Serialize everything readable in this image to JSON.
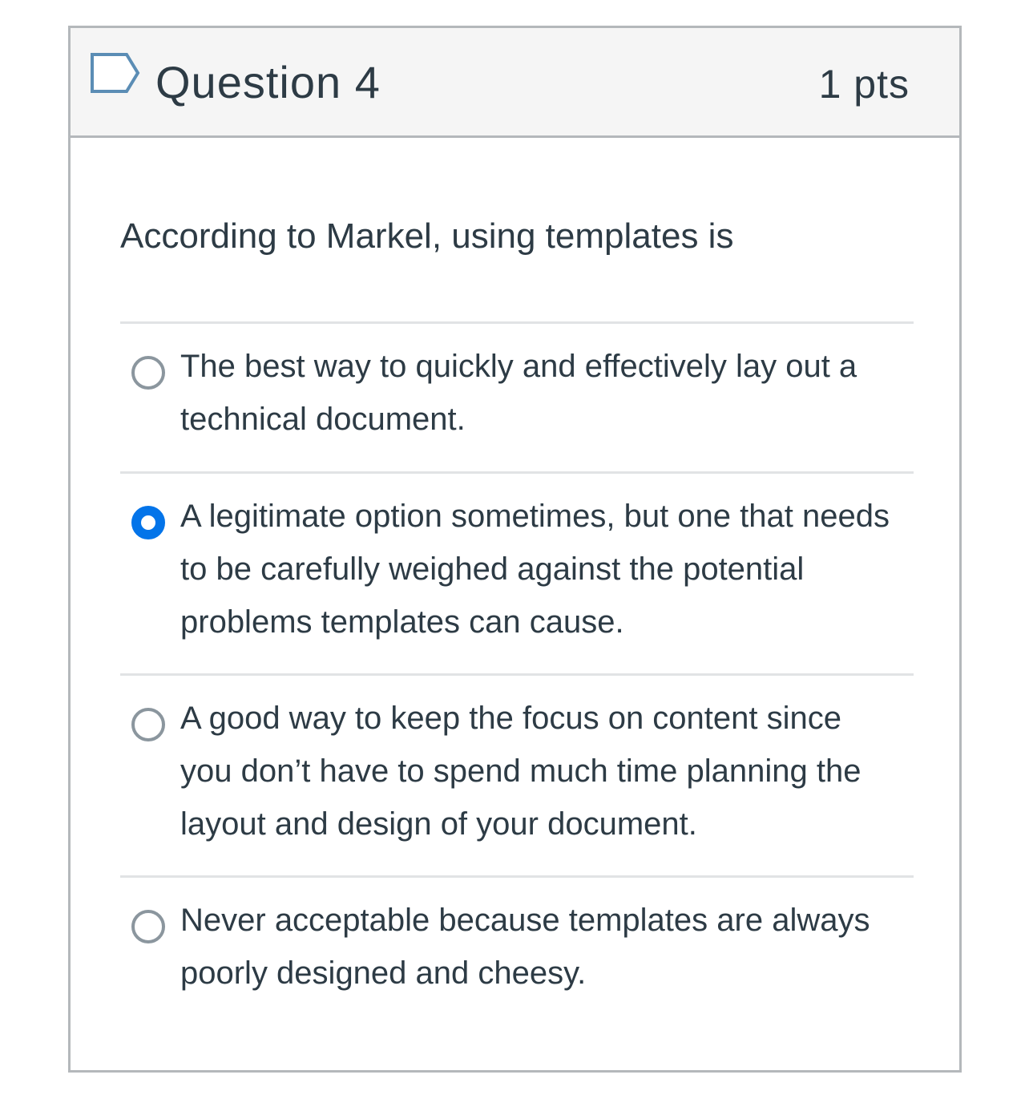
{
  "question": {
    "title": "Question 4",
    "points": "1 pts",
    "text": "According to Markel, using templates is",
    "flag_icon": "flag-outline-icon",
    "accent_color": "#0374e9"
  },
  "answers": [
    {
      "label": "The best way to quickly and effectively lay out a technical document.",
      "selected": false
    },
    {
      "label": "A legitimate option sometimes, but one that needs to be carefully weighed against the potential problems templates can cause.",
      "selected": true
    },
    {
      "label": "A good way to keep the focus on content since you don’t have to spend much time planning the layout and design of your document.",
      "selected": false
    },
    {
      "label": "Never acceptable because templates are always poorly designed and cheesy.",
      "selected": false
    }
  ]
}
